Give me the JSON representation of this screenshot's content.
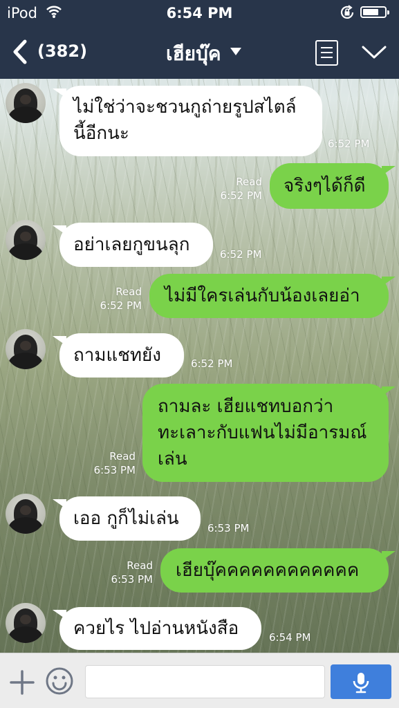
{
  "status_bar": {
    "carrier": "iPod",
    "time": "6:54 PM",
    "battery_level": 0.8
  },
  "header": {
    "unread_count": "(382)",
    "title": "เฮียบุ๊ค"
  },
  "messages": [
    {
      "direction": "in",
      "lines": [
        "ไม่ใช่ว่าจะชวนกูถ่ายรูปสไตล์",
        "นี้อีกนะ"
      ],
      "time": "6:52 PM"
    },
    {
      "direction": "out",
      "lines": [
        "จริงๆได้ก็ดี"
      ],
      "read": "Read",
      "time": "6:52 PM"
    },
    {
      "direction": "in",
      "lines": [
        "อย่าเลยกูขนลุก"
      ],
      "time": "6:52 PM"
    },
    {
      "direction": "out",
      "lines": [
        "ไม่มีใครเล่นกับน้องเลยอ่า"
      ],
      "read": "Read",
      "time": "6:52 PM"
    },
    {
      "direction": "in",
      "lines": [
        "ถามแชทยัง"
      ],
      "time": "6:52 PM"
    },
    {
      "direction": "out",
      "lines": [
        "ถามละ เฮียแชทบอกว่า",
        "ทะเลาะกับแฟนไม่มีอารมณ์",
        "เล่น"
      ],
      "read": "Read",
      "time": "6:53 PM"
    },
    {
      "direction": "in",
      "lines": [
        "เออ กูก็ไม่เล่น"
      ],
      "time": "6:53 PM"
    },
    {
      "direction": "out",
      "lines": [
        "เฮียบุ๊คคคคคคคคคคคค"
      ],
      "read": "Read",
      "time": "6:53 PM"
    },
    {
      "direction": "in",
      "lines": [
        "ควยไร ไปอ่านหนังสือ"
      ],
      "time": "6:54 PM"
    }
  ],
  "input_bar": {
    "message_value": "",
    "message_placeholder": ""
  },
  "colors": {
    "header_bg": "#28354a",
    "outgoing_bubble": "#7ad24a",
    "incoming_bubble": "#ffffff",
    "send_button": "#3f7fdc"
  },
  "icons": [
    "wifi-icon",
    "orientation-lock-icon",
    "battery-icon",
    "back-icon",
    "caret-down-icon",
    "notes-icon",
    "chevron-down-icon",
    "plus-icon",
    "emoji-icon",
    "microphone-icon"
  ]
}
